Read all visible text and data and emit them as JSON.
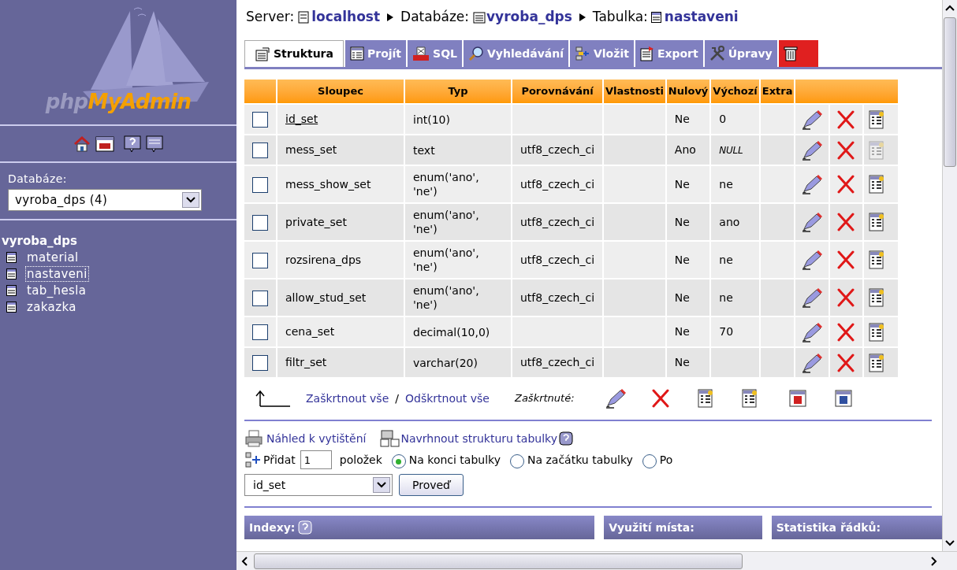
{
  "sidebar": {
    "logo": {
      "php": "php",
      "myadmin": "MyAdmin"
    },
    "database_label": "Databáze:",
    "database_select": {
      "value": "vyroba_dps (4)"
    },
    "database_name": "vyroba_dps",
    "tables": [
      {
        "name": "material",
        "selected": false
      },
      {
        "name": "nastaveni",
        "selected": true
      },
      {
        "name": "tab_hesla",
        "selected": false
      },
      {
        "name": "zakazka",
        "selected": false
      }
    ]
  },
  "breadcrumb": {
    "server_label": "Server:",
    "server": "localhost",
    "database_label": "Databáze:",
    "database": "vyroba_dps",
    "table_label": "Tabulka:",
    "table": "nastaveni"
  },
  "tabs": [
    {
      "label": "Struktura",
      "kind": "structure",
      "selected": true
    },
    {
      "label": "Projít",
      "kind": "browse",
      "selected": false
    },
    {
      "label": "SQL",
      "kind": "sql",
      "selected": false
    },
    {
      "label": "Vyhledávání",
      "kind": "search",
      "selected": false
    },
    {
      "label": "Vložit",
      "kind": "insert",
      "selected": false
    },
    {
      "label": "Export",
      "kind": "export",
      "selected": false
    },
    {
      "label": "Úpravy",
      "kind": "tools",
      "selected": false
    },
    {
      "kind": "drop",
      "selected": false
    }
  ],
  "table": {
    "columns": [
      "Sloupec",
      "Typ",
      "Porovnávání",
      "Vlastnosti",
      "Nulový",
      "Výchozí",
      "Extra"
    ],
    "rows": [
      {
        "checked": false,
        "name": "id_set",
        "primary": true,
        "type": "int(10)",
        "collation": "",
        "null": "Ne",
        "default": "0",
        "index_disabled": false
      },
      {
        "checked": false,
        "name": "mess_set",
        "primary": false,
        "type": "text",
        "collation": "utf8_czech_ci",
        "null": "Ano",
        "default": "NULL",
        "default_is_null": true,
        "index_disabled": true
      },
      {
        "checked": false,
        "name": "mess_show_set",
        "primary": false,
        "type": "enum('ano', 'ne')",
        "collation": "utf8_czech_ci",
        "null": "Ne",
        "default": "ne",
        "index_disabled": false
      },
      {
        "checked": false,
        "name": "private_set",
        "primary": false,
        "type": "enum('ano', 'ne')",
        "collation": "utf8_czech_ci",
        "null": "Ne",
        "default": "ano",
        "index_disabled": false
      },
      {
        "checked": false,
        "name": "rozsirena_dps",
        "primary": false,
        "type": "enum('ano', 'ne')",
        "collation": "utf8_czech_ci",
        "null": "Ne",
        "default": "ne",
        "index_disabled": false
      },
      {
        "checked": false,
        "name": "allow_stud_set",
        "primary": false,
        "type": "enum('ano', 'ne')",
        "collation": "utf8_czech_ci",
        "null": "Ne",
        "default": "ne",
        "index_disabled": false
      },
      {
        "checked": false,
        "name": "cena_set",
        "primary": false,
        "type": "decimal(10,0)",
        "collation": "",
        "null": "Ne",
        "default": "70",
        "index_disabled": false
      },
      {
        "checked": false,
        "name": "filtr_set",
        "primary": false,
        "type": "varchar(20)",
        "collation": "utf8_czech_ci",
        "null": "Ne",
        "default": "",
        "index_disabled": false
      }
    ]
  },
  "check_all": "Zaškrtnout vše",
  "separator": "/",
  "uncheck_all": "Odškrtnout vše",
  "with_selected": "Zaškrtnuté:",
  "print_view": "Náhled k vytištění",
  "propose_structure": "Navrhnout strukturu tabulky",
  "add_fields": {
    "label": "Přidat",
    "count": "1",
    "unit": "položek",
    "positions": [
      {
        "label": "Na konci tabulky",
        "selected": true
      },
      {
        "label": "Na začátku tabulky",
        "selected": false
      },
      {
        "label": "Po",
        "selected": false
      }
    ],
    "after_select": "id_set",
    "button": "Proveď"
  },
  "sections": [
    "Indexy:",
    "Využití místa:",
    "Statistika řádků:"
  ]
}
